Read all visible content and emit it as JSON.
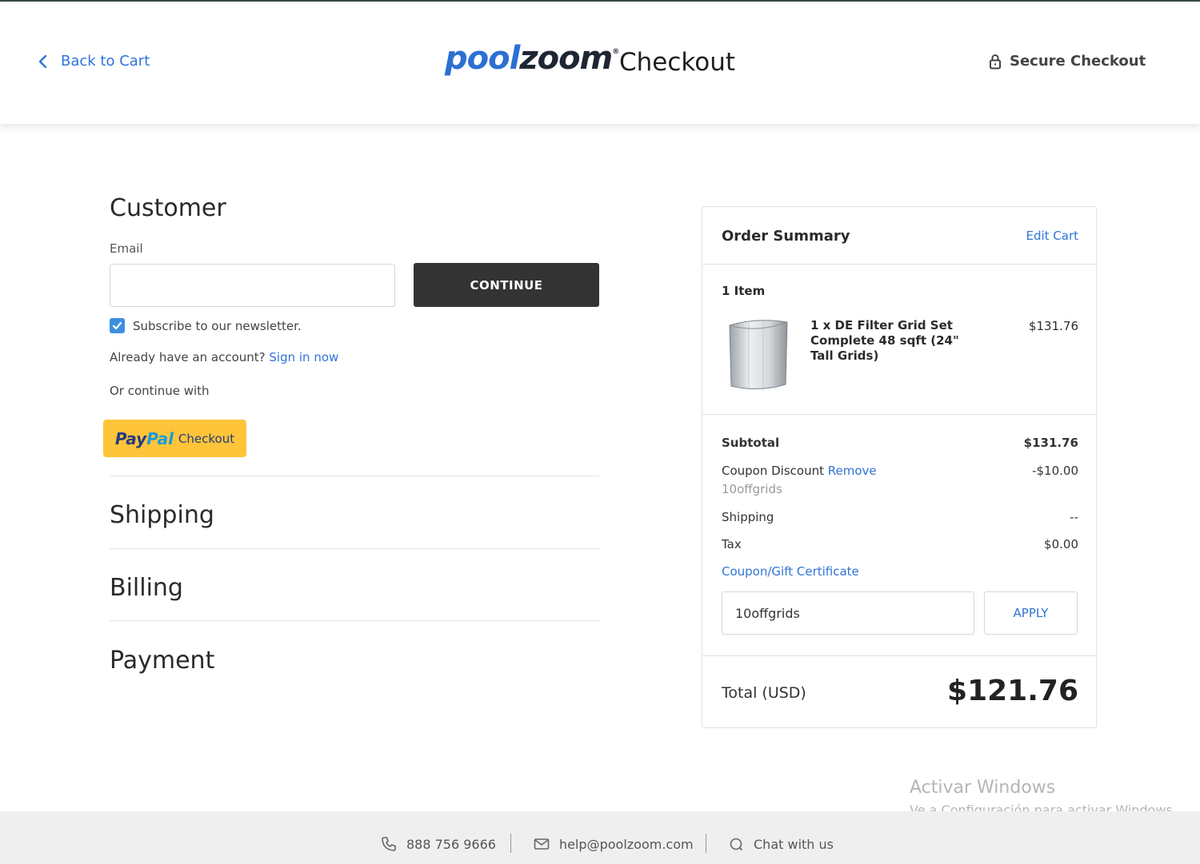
{
  "header": {
    "back_label": "Back to Cart",
    "logo_pool": "pool",
    "logo_zoom": "zoom",
    "logo_reg": "®",
    "title": "Checkout",
    "secure_label": "Secure Checkout"
  },
  "customer": {
    "title": "Customer",
    "email_label": "Email",
    "email_value": "",
    "continue_label": "CONTINUE",
    "newsletter_label": "Subscribe to our newsletter.",
    "newsletter_checked": true,
    "account_prompt": "Already have an account?",
    "sign_in_label": "Sign in now",
    "or_continue": "Or continue with",
    "paypal_pay": "Pay",
    "paypal_pal": "Pal",
    "paypal_checkout": "Checkout"
  },
  "sections": {
    "shipping": "Shipping",
    "billing": "Billing",
    "payment": "Payment"
  },
  "summary": {
    "title": "Order Summary",
    "edit_cart": "Edit Cart",
    "item_count": "1 Item",
    "item": {
      "name": "1 x DE Filter Grid Set Complete 48 sqft (24\" Tall Grids)",
      "price": "$131.76"
    },
    "subtotal_label": "Subtotal",
    "subtotal_value": "$131.76",
    "coupon_label": "Coupon Discount",
    "remove_label": "Remove",
    "coupon_value": "-$10.00",
    "coupon_code": "10offgrids",
    "shipping_label": "Shipping",
    "shipping_value": "--",
    "tax_label": "Tax",
    "tax_value": "$0.00",
    "coupon_link": "Coupon/Gift Certificate",
    "coupon_input_value": "10offgrids",
    "apply_label": "APPLY",
    "total_label": "Total (USD)",
    "total_value": "$121.76"
  },
  "footer": {
    "phone": "888 756 9666",
    "email": "help@poolzoom.com",
    "chat": "Chat with us"
  },
  "watermark": {
    "line1": "Activar Windows",
    "line2": "Ve a Configuración para activar Windows."
  },
  "colors": {
    "accent": "#2f74d8",
    "button_dark": "#333333",
    "paypal_yellow": "#ffc439"
  }
}
